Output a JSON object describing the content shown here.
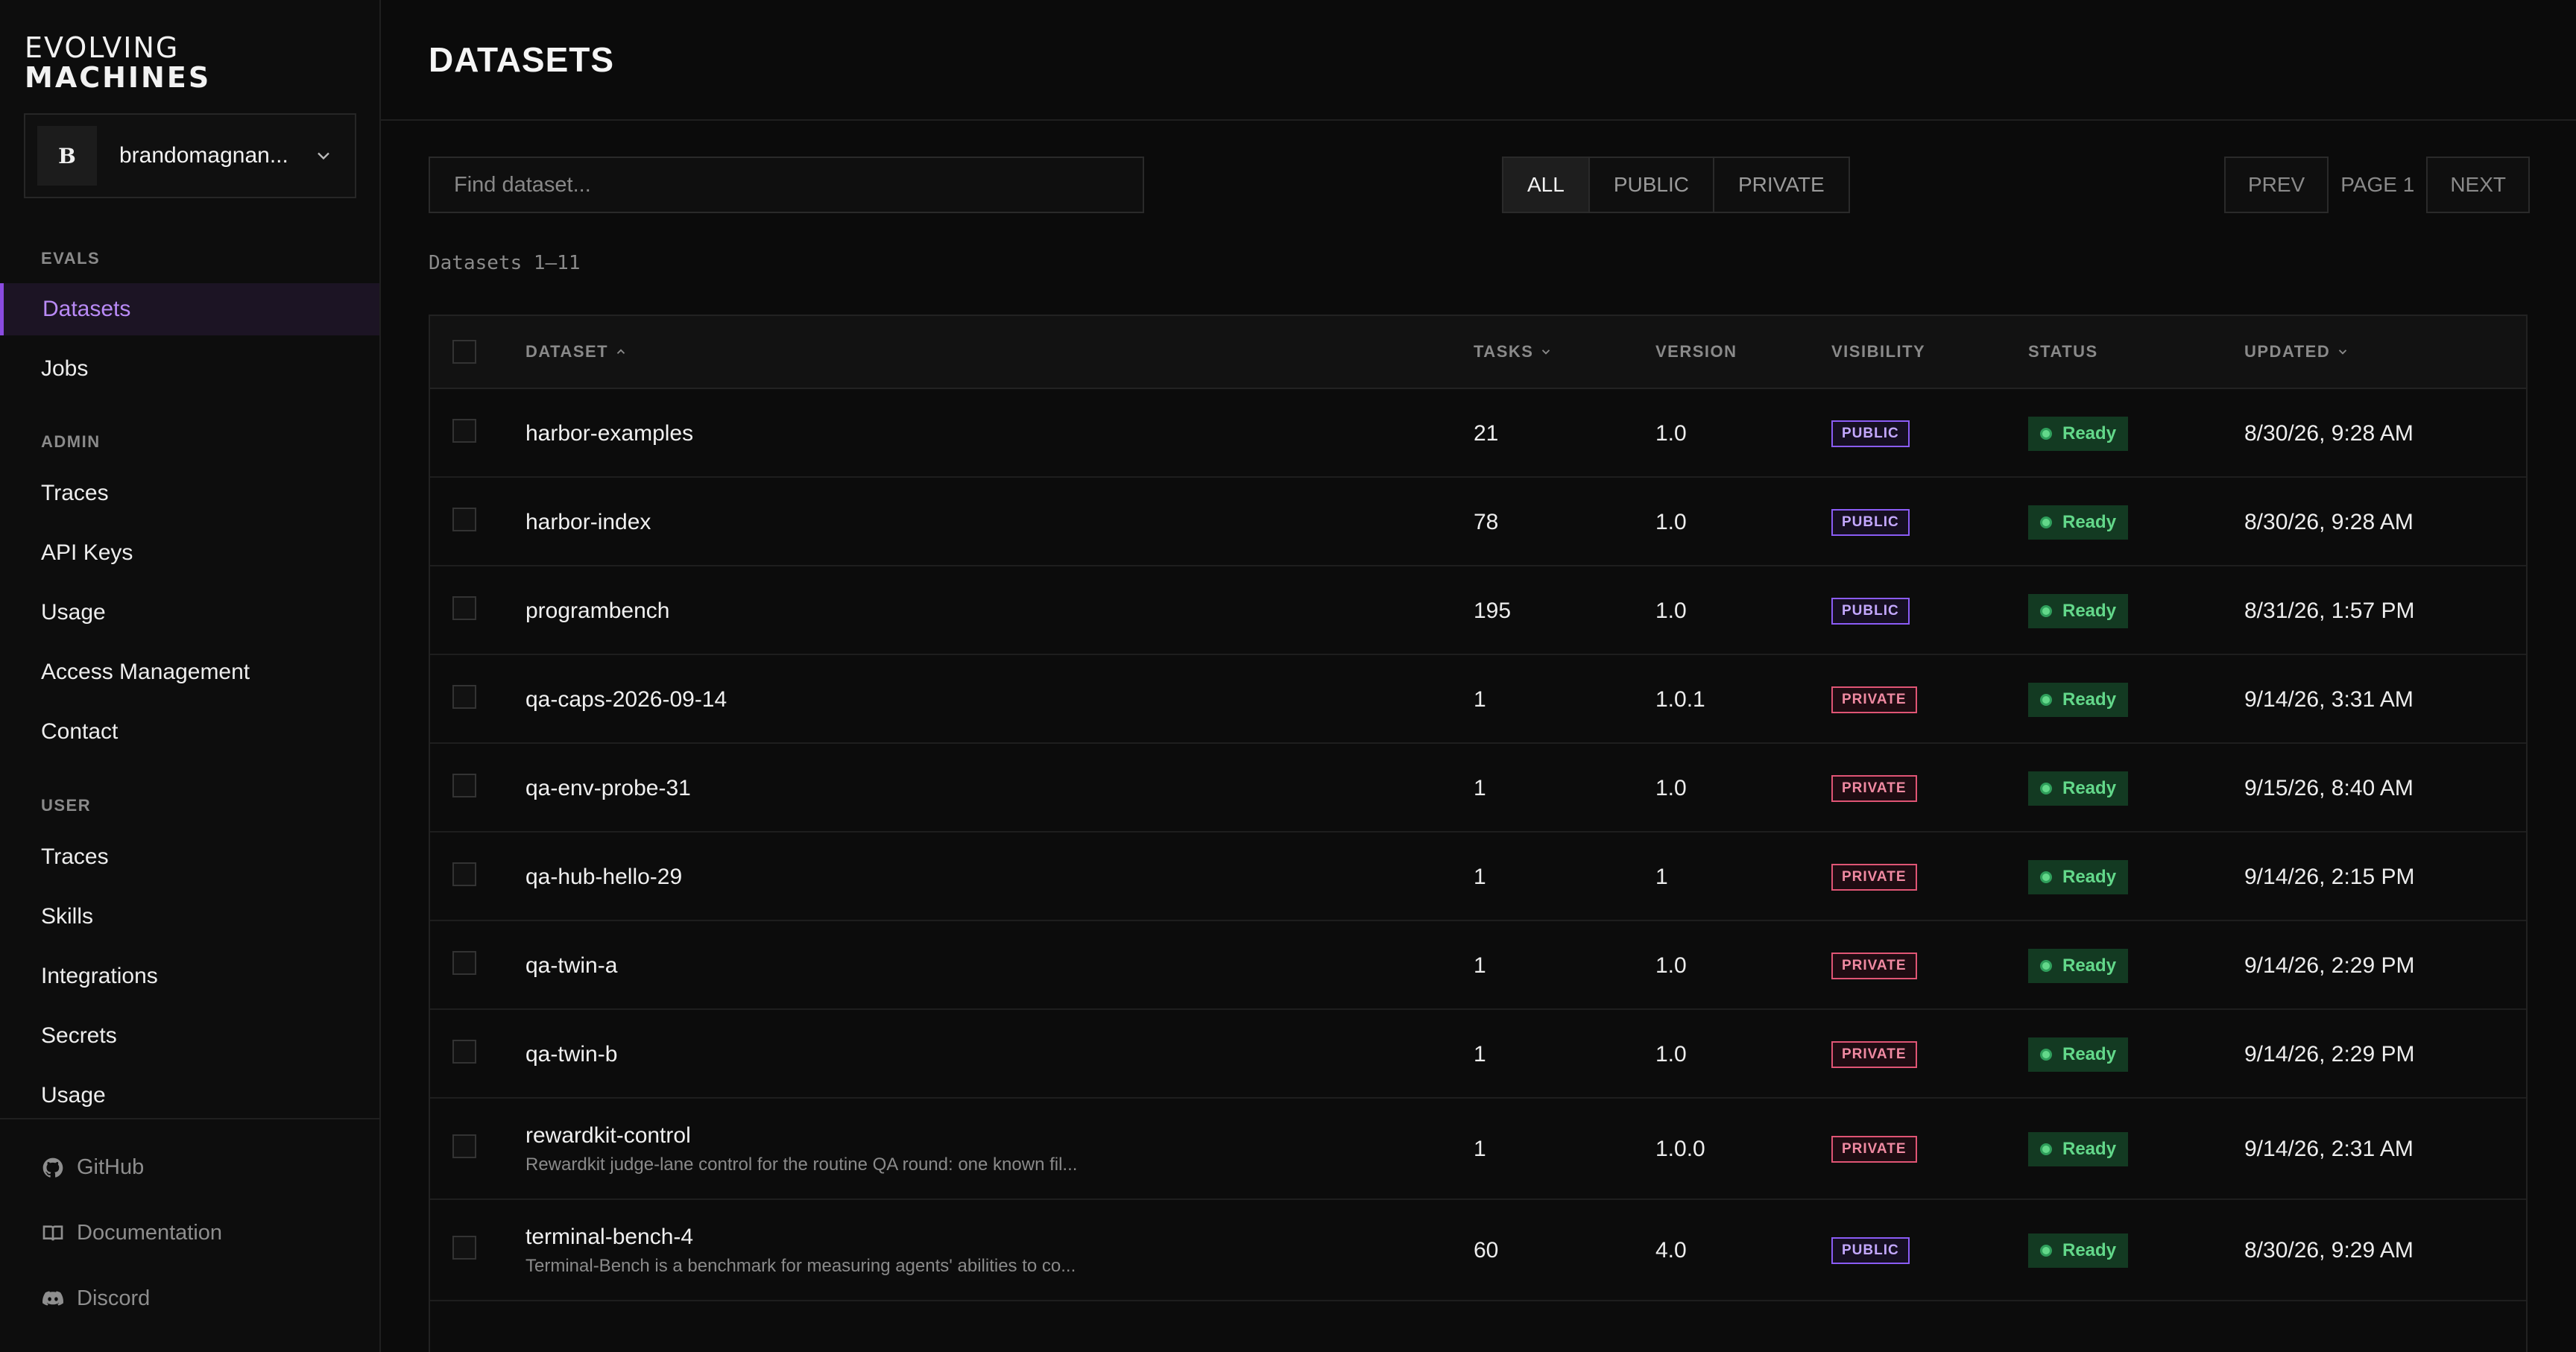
{
  "brand": {
    "line1": "EVOLVING",
    "line2": "MACHINES"
  },
  "account": {
    "initial": "B",
    "name": "brandomagnan..."
  },
  "nav": {
    "sections": [
      {
        "title": "EVALS",
        "items": [
          "Datasets",
          "Jobs"
        ]
      },
      {
        "title": "ADMIN",
        "items": [
          "Traces",
          "API Keys",
          "Usage",
          "Access Management",
          "Contact"
        ]
      },
      {
        "title": "USER",
        "items": [
          "Traces",
          "Skills",
          "Integrations",
          "Secrets",
          "Usage"
        ]
      }
    ],
    "active": "Datasets"
  },
  "footer_links": [
    {
      "label": "GitHub",
      "icon": "github-icon"
    },
    {
      "label": "Documentation",
      "icon": "book-icon"
    },
    {
      "label": "Discord",
      "icon": "discord-icon"
    }
  ],
  "page": {
    "title": "DATASETS"
  },
  "search": {
    "placeholder": "Find dataset...",
    "value": ""
  },
  "filters": {
    "options": [
      "ALL",
      "PUBLIC",
      "PRIVATE"
    ],
    "selected": "ALL"
  },
  "pager": {
    "prev": "PREV",
    "label": "PAGE 1",
    "next": "NEXT"
  },
  "range_label": "Datasets 1–11",
  "table": {
    "columns": [
      "DATASET",
      "TASKS",
      "VERSION",
      "VISIBILITY",
      "STATUS",
      "UPDATED"
    ],
    "rows": [
      {
        "name": "harbor-examples",
        "desc": "",
        "tasks": "21",
        "version": "1.0",
        "visibility": "PUBLIC",
        "status": "Ready",
        "updated": "8/30/26, 9:28 AM"
      },
      {
        "name": "harbor-index",
        "desc": "",
        "tasks": "78",
        "version": "1.0",
        "visibility": "PUBLIC",
        "status": "Ready",
        "updated": "8/30/26, 9:28 AM"
      },
      {
        "name": "programbench",
        "desc": "",
        "tasks": "195",
        "version": "1.0",
        "visibility": "PUBLIC",
        "status": "Ready",
        "updated": "8/31/26, 1:57 PM"
      },
      {
        "name": "qa-caps-2026-09-14",
        "desc": "",
        "tasks": "1",
        "version": "1.0.1",
        "visibility": "PRIVATE",
        "status": "Ready",
        "updated": "9/14/26, 3:31 AM"
      },
      {
        "name": "qa-env-probe-31",
        "desc": "",
        "tasks": "1",
        "version": "1.0",
        "visibility": "PRIVATE",
        "status": "Ready",
        "updated": "9/15/26, 8:40 AM"
      },
      {
        "name": "qa-hub-hello-29",
        "desc": "",
        "tasks": "1",
        "version": "1",
        "visibility": "PRIVATE",
        "status": "Ready",
        "updated": "9/14/26, 2:15 PM"
      },
      {
        "name": "qa-twin-a",
        "desc": "",
        "tasks": "1",
        "version": "1.0",
        "visibility": "PRIVATE",
        "status": "Ready",
        "updated": "9/14/26, 2:29 PM"
      },
      {
        "name": "qa-twin-b",
        "desc": "",
        "tasks": "1",
        "version": "1.0",
        "visibility": "PRIVATE",
        "status": "Ready",
        "updated": "9/14/26, 2:29 PM"
      },
      {
        "name": "rewardkit-control",
        "desc": "Rewardkit judge-lane control for the routine QA round: one known fil...",
        "tasks": "1",
        "version": "1.0.0",
        "visibility": "PRIVATE",
        "status": "Ready",
        "updated": "9/14/26, 2:31 AM"
      },
      {
        "name": "terminal-bench-4",
        "desc": "Terminal-Bench is a benchmark for measuring agents' abilities to co...",
        "tasks": "60",
        "version": "4.0",
        "visibility": "PUBLIC",
        "status": "Ready",
        "updated": "8/30/26, 9:29 AM"
      }
    ]
  },
  "colors": {
    "accent": "#8a4be0",
    "public": "#8b5cf6",
    "private": "#e05575",
    "ready": "#63d88a"
  }
}
